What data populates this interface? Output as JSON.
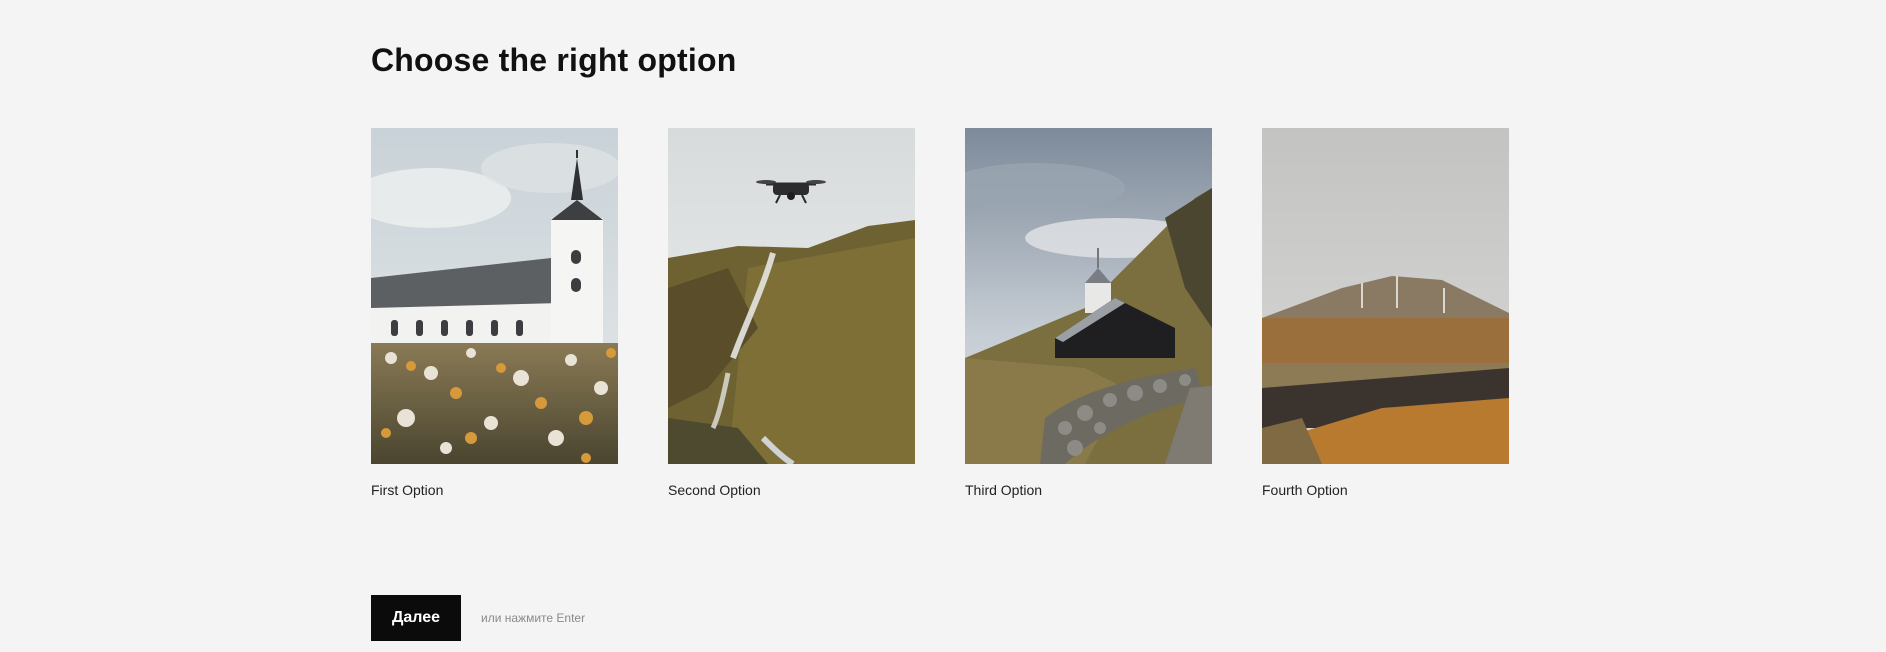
{
  "page": {
    "title": "Choose the right option"
  },
  "options": [
    {
      "label": "First Option",
      "image": "church-with-flowers"
    },
    {
      "label": "Second Option",
      "image": "drone-over-waterfall"
    },
    {
      "label": "Third Option",
      "image": "black-church-stone-wall"
    },
    {
      "label": "Fourth Option",
      "image": "wind-turbines-moorland"
    }
  ],
  "footer": {
    "next_label": "Далее",
    "hint": "или нажмите Enter"
  }
}
